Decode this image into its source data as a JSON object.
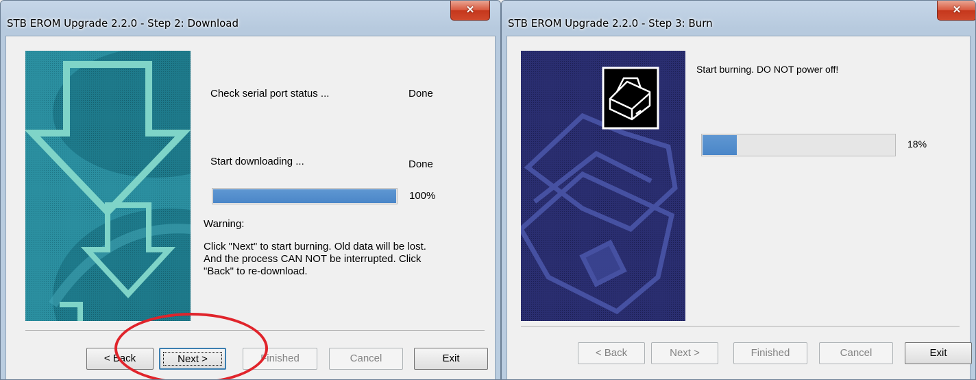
{
  "step2": {
    "title": "STB EROM Upgrade 2.2.0  - Step 2: Download",
    "close_icon": "close-icon",
    "check_label": "Check serial port status ...",
    "check_status": "Done",
    "download_label": "Start downloading ...",
    "download_status": "Done",
    "progress_text": "100%",
    "progress_value": 1.0,
    "warning_title": "Warning:",
    "warning_line1": "Click \"Next\" to start burning. Old data will be lost.",
    "warning_line2": "And the process CAN NOT be interrupted. Click",
    "warning_line3": "\"Back\" to re-download.",
    "buttons": {
      "back": "< Back",
      "next": "Next >",
      "finished": "Finished",
      "cancel": "Cancel",
      "exit": "Exit"
    }
  },
  "step3": {
    "title": "STB EROM Upgrade 2.2.0  - Step 3: Burn",
    "close_icon": "close-icon",
    "status_text": "Start burning. DO NOT power off!",
    "progress_text": "18%",
    "progress_value": 0.18,
    "buttons": {
      "back": "< Back",
      "next": "Next >",
      "finished": "Finished",
      "cancel": "Cancel",
      "exit": "Exit"
    }
  },
  "colors": {
    "progress_fill": "#4a86c8",
    "banner_download": "#2a8c9d",
    "banner_burn": "#2a2d6c",
    "annotation": "#e0242b"
  }
}
